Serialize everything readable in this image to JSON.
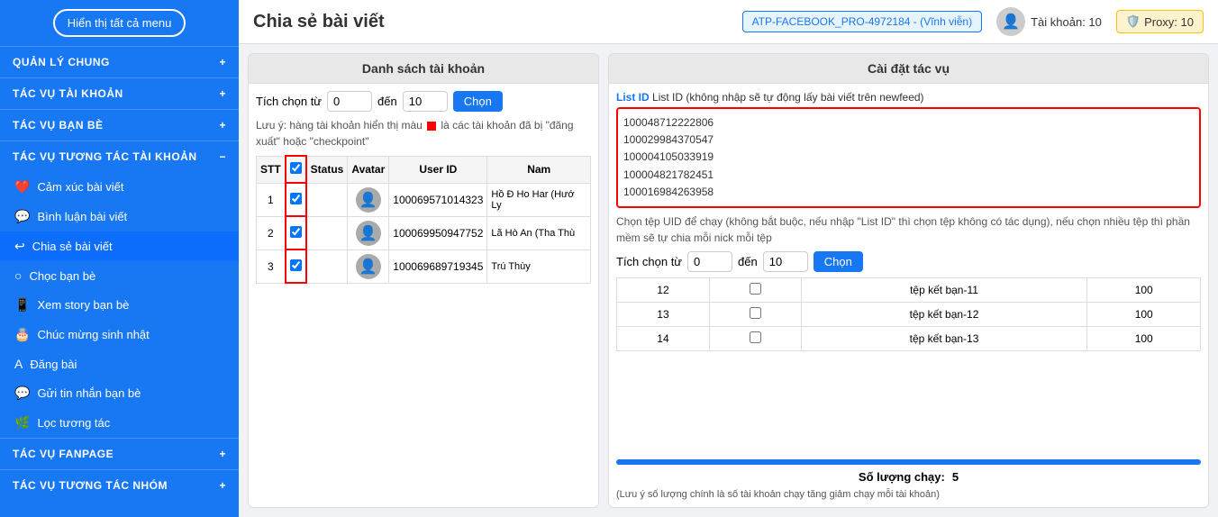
{
  "sidebar": {
    "toggle_label": "Hiển thị tất cả menu",
    "sections": [
      {
        "id": "quan-ly-chung",
        "label": "QUẢN LÝ CHUNG",
        "icon": "+",
        "items": []
      },
      {
        "id": "tac-vu-tai-khoan",
        "label": "TÁC VỤ TÀI KHOẢN",
        "icon": "+",
        "items": []
      },
      {
        "id": "tac-vu-ban-be",
        "label": "TÁC VỤ BẠN BÈ",
        "icon": "+",
        "items": []
      },
      {
        "id": "tac-vu-tuong-tac",
        "label": "TÁC VỤ TƯƠNG TÁC TÀI KHOẢN",
        "icon": "−",
        "items": [
          {
            "id": "cam-xuc-bai-viet",
            "icon": "❤️",
            "label": "Cảm xúc bài viết"
          },
          {
            "id": "binh-luan-bai-viet",
            "icon": "💬",
            "label": "Bình luận bài viết"
          },
          {
            "id": "chia-se-bai-viet",
            "icon": "↩",
            "label": "Chia sẻ bài viết",
            "active": true
          },
          {
            "id": "choc-ban-be",
            "icon": "○",
            "label": "Chọc bạn bè"
          },
          {
            "id": "xem-story-ban-be",
            "icon": "📱",
            "label": "Xem story bạn bè"
          },
          {
            "id": "chuc-mung-sinh-nhat",
            "icon": "🎂",
            "label": "Chúc mừng sinh nhật"
          },
          {
            "id": "dang-bai",
            "icon": "A",
            "label": "Đăng bài"
          },
          {
            "id": "gui-tin-nhan-ban-be",
            "icon": "💬",
            "label": "Gửi tin nhắn bạn bè"
          },
          {
            "id": "loc-tuong-tac",
            "icon": "🌿",
            "label": "Lọc tương tác"
          }
        ]
      },
      {
        "id": "tac-vu-fanpage",
        "label": "TÁC VỤ FANPAGE",
        "icon": "+",
        "items": []
      },
      {
        "id": "tac-vu-tuong-tac-nhom",
        "label": "TÁC VỤ TƯƠNG TÁC NHÓM",
        "icon": "+",
        "items": []
      }
    ]
  },
  "header": {
    "title": "Chia sẻ bài viết",
    "badge": "ATP-FACEBOOK_PRO-4972184 - (Vĩnh viễn)",
    "account_label": "Tài khoản: 10",
    "proxy_label": "Proxy: 10"
  },
  "left_panel": {
    "title": "Danh sách tài khoản",
    "select_from_label": "Tích chọn từ",
    "select_from_value": "0",
    "select_to_label": "đến",
    "select_to_value": "10",
    "select_btn": "Chọn",
    "warning": "Lưu ý: hàng tài khoản hiển thị màu  là các tài khoản đã bị \"đăng xuất\" hoặc \"checkpoint\"",
    "table": {
      "columns": [
        "STT",
        "☑",
        "Status",
        "Avatar",
        "User ID",
        "Nam"
      ],
      "rows": [
        {
          "stt": "1",
          "checked": true,
          "status": "",
          "avatar": "👤",
          "user_id": "100069571014323",
          "name": "Hồ Đ\nHo\nHar\n(Hướ\nLy"
        },
        {
          "stt": "2",
          "checked": true,
          "status": "",
          "avatar": "👤",
          "user_id": "100069950947752",
          "name": "Lã Hò\nAn\n(Tha\nThù"
        },
        {
          "stt": "3",
          "checked": true,
          "status": "",
          "avatar": "👤",
          "user_id": "100069689719345",
          "name": "Trú\nThùy"
        }
      ]
    }
  },
  "right_panel": {
    "title": "Cài đặt tác vụ",
    "list_id_label": "List ID (không nhập sẽ tự động lấy bài viết trên newfeed)",
    "list_id_values": [
      "100048712222806",
      "100029984370547",
      "100004105033919",
      "100004821782451",
      "100016984263958"
    ],
    "uid_section_desc": "Chọn tệp UID để chạy (không bắt buộc, nếu nhập \"List ID\" thì chọn tệp không có tác dụng), nếu chọn nhiều tệp thì phần mềm sẽ tự chia mỗi nick mỗi tệp",
    "select_from_label": "Tích chọn từ",
    "select_from_value": "0",
    "select_to_label": "đến",
    "select_to_value": "10",
    "select_btn": "Chọn",
    "uid_table": {
      "columns": [
        "",
        "",
        "tên tệp",
        ""
      ],
      "rows": [
        {
          "num": "12",
          "checked": false,
          "name": "tệp kết bạn-11",
          "count": "100"
        },
        {
          "num": "13",
          "checked": false,
          "name": "tệp kết bạn-12",
          "count": "100"
        },
        {
          "num": "14",
          "checked": false,
          "name": "tệp kết bạn-13",
          "count": "100"
        }
      ]
    },
    "so_luong_label": "Số lượng chạy:",
    "so_luong_value": "5",
    "note": "(Lưu ý số lượng chính là số tài khoản chạy tăng giảm chạy mỗi tài khoản)"
  }
}
